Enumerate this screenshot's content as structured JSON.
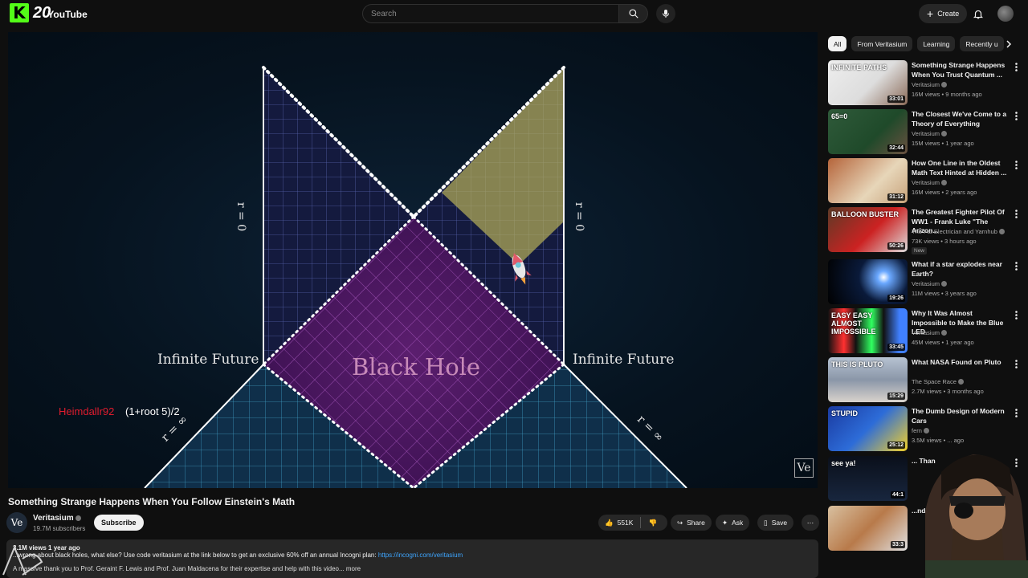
{
  "header": {
    "logo_k": "K",
    "logo_20": "20",
    "logo_youtube": "YouTube",
    "search_placeholder": "Search",
    "create_label": "Create"
  },
  "video": {
    "labels": {
      "infinite_future_left": "Infinite Future",
      "infinite_future_right": "Infinite Future",
      "black_hole": "Black Hole",
      "r0_left": "r = 0",
      "r0_right": "r = 0",
      "rinf_left": "r = ∞",
      "rinf_right": "r = ∞"
    },
    "chat_user": "Heimdallr92",
    "chat_message": "(1+root 5)/2",
    "watermark": "Ve"
  },
  "details": {
    "title": "Something Strange Happens When You Follow Einstein's Math",
    "channel": "Veritasium",
    "channel_avatar": "Ve",
    "subscribers": "19.7M subscribers",
    "subscribe_label": "Subscribe",
    "likes": "551K",
    "share_label": "Share",
    "ask_label": "Ask",
    "save_label": "Save",
    "desc_meta": "3.1M views  1 year ago",
    "desc_line1": "...wrong about black holes, what else? Use code veritasium at the link below to get an exclusive 60% off an annual Incogni plan:",
    "desc_link": "https://incogni.com/veritasium",
    "desc_line2": "A massive thank you to Prof. Geraint F. Lewis and Prof. Juan Maldacena for their expertise and help with this video...   more"
  },
  "chips": [
    "All",
    "From Veritasium",
    "Learning",
    "Recently u"
  ],
  "recommendations": [
    {
      "title": "Something Strange Happens When You Trust Quantum ...",
      "channel": "Veritasium",
      "meta": "16M views • 9 months ago",
      "duration": "33:01",
      "thumb_text": "INFINITE PATHS"
    },
    {
      "title": "The Closest We've Come to a Theory of Everything",
      "channel": "Veritasium",
      "meta": "15M views • 1 year ago",
      "duration": "32:44",
      "thumb_text": "65=0"
    },
    {
      "title": "How One Line in the Oldest Math Text Hinted at Hidden ...",
      "channel": "Veritasium",
      "meta": "16M views • 2 years ago",
      "duration": "31:12",
      "thumb_text": ""
    },
    {
      "title": "The Greatest Fighter Pilot Of WW1 - Frank Luke \"The Arizon...",
      "channel": "The Fat Electrician and Yarnhub",
      "meta": "73K views • 3 hours ago",
      "duration": "50:26",
      "badge": "New",
      "thumb_text": "BALLOON BUSTER"
    },
    {
      "title": "What if a star explodes near Earth?",
      "channel": "Veritasium",
      "meta": "11M views • 3 years ago",
      "duration": "19:26",
      "thumb_text": ""
    },
    {
      "title": "Why It Was Almost Impossible to Make the Blue LED",
      "channel": "Veritasium",
      "meta": "45M views • 1 year ago",
      "duration": "33:45",
      "thumb_text": "EASY EASY ALMOST IMPOSSIBLE"
    },
    {
      "title": "What NASA Found on Pluto",
      "channel": "The Space Race",
      "meta": "2.7M views • 3 months ago",
      "duration": "15:29",
      "thumb_text": "THIS IS PLUTO"
    },
    {
      "title": "The Dumb Design of Modern Cars",
      "channel": "fern",
      "meta": "3.5M views • ... ago",
      "duration": "25:12",
      "thumb_text": "STUPID"
    },
    {
      "title": "... Than",
      "channel": "",
      "meta": "",
      "duration": "44:1",
      "thumb_text": "see ya!"
    },
    {
      "title": "...nd",
      "channel": "",
      "meta": "",
      "duration": "33:3",
      "thumb_text": ""
    }
  ],
  "colors": {
    "bg": "#0f0f0f",
    "chat_user": "#e01c2e",
    "link": "#3ea6ff",
    "kick_green": "#53fc18"
  }
}
